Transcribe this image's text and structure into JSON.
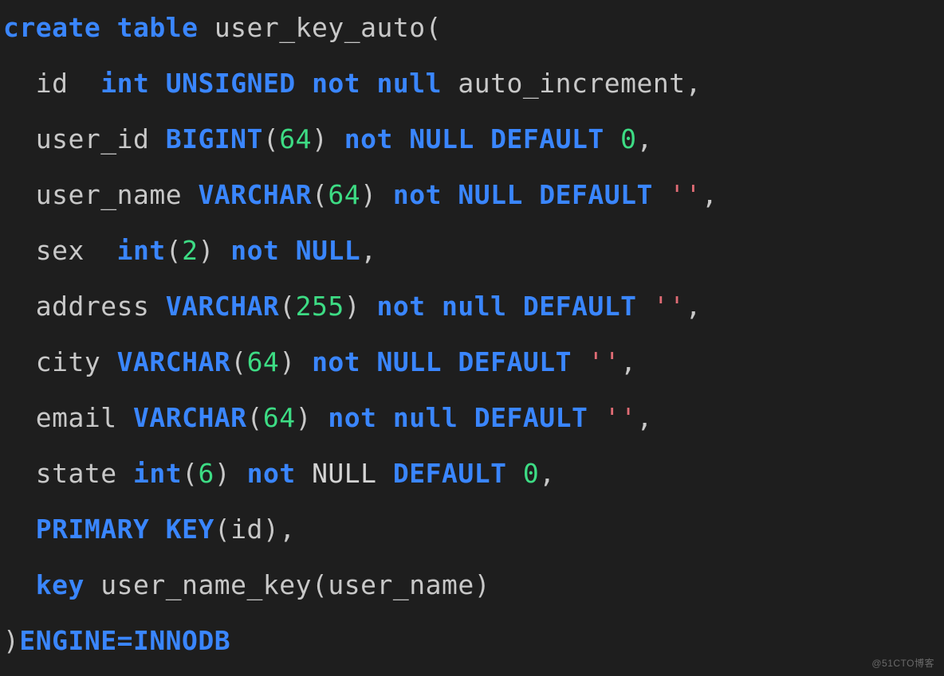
{
  "watermark": "@51CTO博客",
  "code": {
    "l1": {
      "create": "create",
      "table": "table",
      "name": "user_key_auto",
      "paren": "("
    },
    "l2": {
      "col": "id",
      "int": "int",
      "unsigned": "UNSIGNED",
      "not": "not",
      "null": "null",
      "auto": "auto_increment",
      "comma": ","
    },
    "l3": {
      "col": "user_id",
      "bigint": "BIGINT",
      "lp": "(",
      "n": "64",
      "rp": ")",
      "not": "not",
      "null": "NULL",
      "default": "DEFAULT",
      "val": "0",
      "comma": ","
    },
    "l4": {
      "col": "user_name",
      "varchar": "VARCHAR",
      "lp": "(",
      "n": "64",
      "rp": ")",
      "not": "not",
      "null": "NULL",
      "default": "DEFAULT",
      "val": "''",
      "comma": ","
    },
    "l5": {
      "col": "sex",
      "int": "int",
      "lp": "(",
      "n": "2",
      "rp": ")",
      "not": "not",
      "null": "NULL",
      "comma": ","
    },
    "l6": {
      "col": "address",
      "varchar": "VARCHAR",
      "lp": "(",
      "n": "255",
      "rp": ")",
      "not": "not",
      "null": "null",
      "default": "DEFAULT",
      "val": "''",
      "comma": ","
    },
    "l7": {
      "col": "city",
      "varchar": "VARCHAR",
      "lp": "(",
      "n": "64",
      "rp": ")",
      "not": "not",
      "null": "NULL",
      "default": "DEFAULT",
      "val": "''",
      "comma": ","
    },
    "l8": {
      "col": "email",
      "varchar": "VARCHAR",
      "lp": "(",
      "n": "64",
      "rp": ")",
      "not": "not",
      "null": "null",
      "default": "DEFAULT",
      "val": "''",
      "comma": ","
    },
    "l9": {
      "col": "state",
      "int": "int",
      "lp": "(",
      "n": "6",
      "rp": ")",
      "not": "not",
      "null": "NULL",
      "default": "DEFAULT",
      "val": "0",
      "comma": ","
    },
    "l10": {
      "primary": "PRIMARY",
      "key": "KEY",
      "lp": "(",
      "col": "id",
      "rp": ")",
      "comma": ","
    },
    "l11": {
      "key": "key",
      "name": "user_name_key",
      "lp": "(",
      "col": "user_name",
      "rp": ")"
    },
    "l12": {
      "rp": ")",
      "engine": "ENGINE=INNODB"
    }
  }
}
